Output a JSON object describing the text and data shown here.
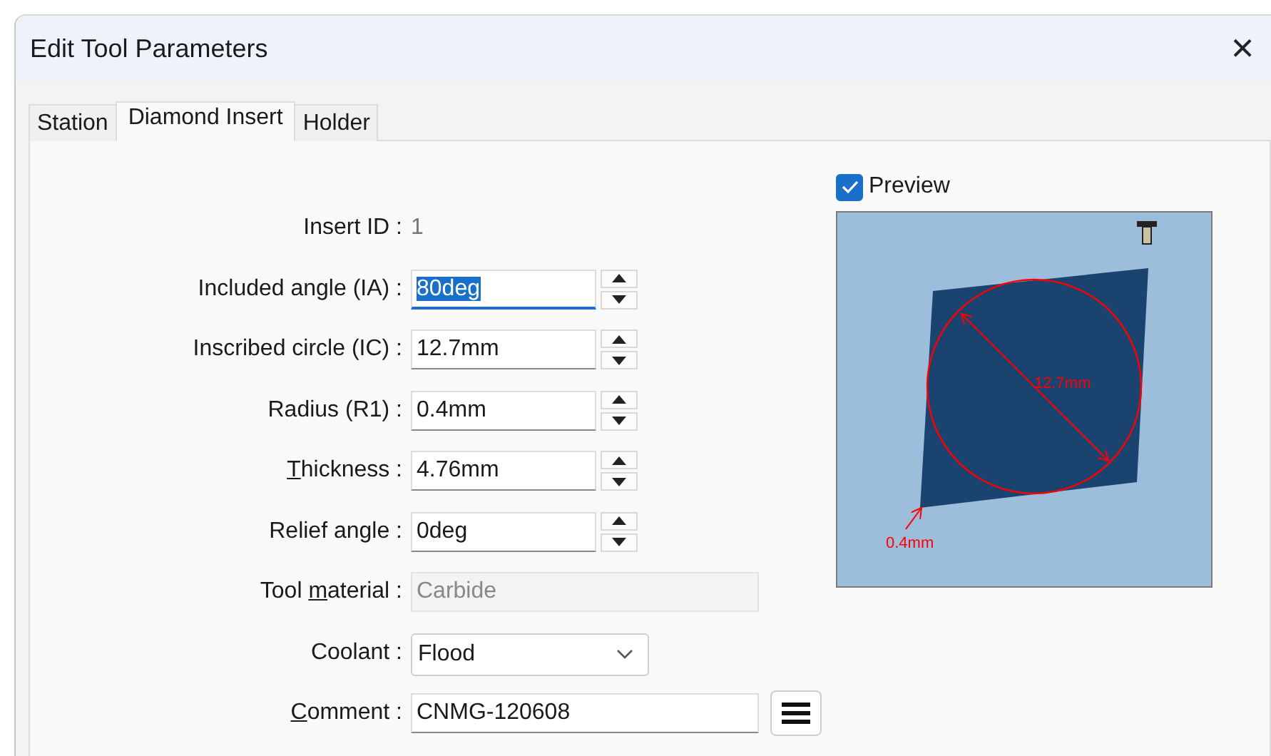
{
  "window": {
    "title": "Edit Tool Parameters",
    "close": "×"
  },
  "tabs": [
    {
      "label": "Station",
      "selected": false
    },
    {
      "label": "Diamond Insert",
      "selected": true
    },
    {
      "label": "Holder",
      "selected": false
    }
  ],
  "fields": [
    {
      "kind": "readout",
      "label": "Insert ID :",
      "value": "1"
    },
    {
      "kind": "spin",
      "label": "Included angle (IA) :",
      "value": "80deg",
      "focused": true,
      "value_selected": true
    },
    {
      "kind": "spin",
      "label": "Inscribed circle (IC) :",
      "value": "12.7mm",
      "focused": false,
      "value_selected": false
    },
    {
      "kind": "spin",
      "label": "Radius (R1) :",
      "value": "0.4mm",
      "focused": false,
      "value_selected": false
    },
    {
      "kind": "spin",
      "label": {
        "key": "T",
        "after": "hickness :"
      },
      "value": "4.76mm",
      "focused": false,
      "value_selected": false
    },
    {
      "kind": "spin",
      "label": "Relief angle :",
      "value": "0deg",
      "focused": false,
      "value_selected": false
    },
    {
      "kind": "text",
      "label": {
        "before": "Tool ",
        "key": "m",
        "after": "aterial :"
      },
      "value": "Carbide",
      "disabled": true
    },
    {
      "kind": "dropdown",
      "label": "Coolant :",
      "value": "Flood"
    },
    {
      "kind": "text_button",
      "label": {
        "key": "C",
        "after": "omment :"
      },
      "value": "CNMG-120608",
      "disabled": false
    }
  ],
  "preview": {
    "label": "Preview",
    "checked": true,
    "diameter_label": "12.7mm",
    "radius_label": "0.4mm"
  }
}
